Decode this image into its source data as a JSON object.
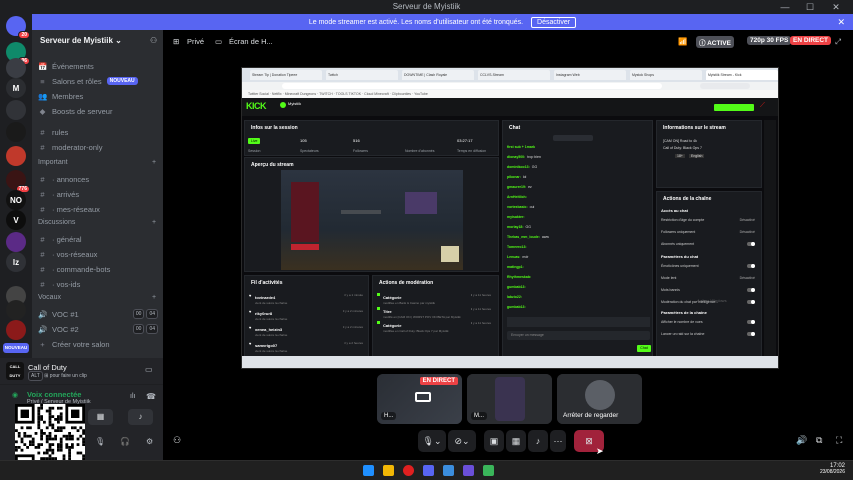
{
  "window": {
    "title": "Serveur de Myistiik",
    "minimize": "—",
    "maximize": "☐",
    "close": "✕"
  },
  "streamer_mode": {
    "message": "Le mode streamer est activé. Les noms d'utilisateur ont été tronqués.",
    "disable_label": "Désactiver",
    "close": "✕"
  },
  "servers": [
    {
      "label": "",
      "badge": "20",
      "color": "#5865f2"
    },
    {
      "label": "",
      "badge": "96",
      "color": "#0f8a6a"
    },
    {
      "label": "",
      "badge": "",
      "color": "#3a3d44"
    },
    {
      "label": "M",
      "badge": "",
      "color": "#2b2d31"
    },
    {
      "label": "",
      "badge": "",
      "color": "#313338"
    },
    {
      "label": "",
      "badge": "",
      "color": "#1a1a1a"
    },
    {
      "label": "",
      "badge": "",
      "color": "#c0392b"
    },
    {
      "label": "",
      "badge": "776",
      "color": "#3a1414"
    },
    {
      "label": "NO",
      "badge": "",
      "color": "#111"
    },
    {
      "label": "V",
      "badge": "",
      "color": "#0d0d0d"
    },
    {
      "label": "",
      "badge": "",
      "color": "#5b2a86"
    },
    {
      "label": "lz",
      "badge": "",
      "color": "#2f3136"
    },
    {
      "label": "",
      "badge": "",
      "color": "#444"
    },
    {
      "label": "",
      "badge": "",
      "color": "#222"
    },
    {
      "label": "",
      "badge": "",
      "color": "#8b1a1a"
    }
  ],
  "rail_new_label": "NOUVEAU",
  "guild": {
    "name": "Serveur de Myistiik",
    "chevron": "⌄"
  },
  "channels": {
    "top": [
      {
        "icon": "📅",
        "label": "Événements"
      },
      {
        "icon": "≡",
        "label": "Salons et rôles",
        "tag": "NOUVEAU"
      },
      {
        "icon": "👥",
        "label": "Membres"
      },
      {
        "icon": "◆",
        "label": "Boosts de serveur"
      }
    ],
    "plain": [
      {
        "icon": "#",
        "label": "rules"
      },
      {
        "icon": "#",
        "label": "moderator-only"
      }
    ],
    "cat_important": "Important",
    "important": [
      {
        "icon": "#",
        "label": "· annonces"
      },
      {
        "icon": "#",
        "label": "· arrivés"
      },
      {
        "icon": "#",
        "label": "· mes-réseaux"
      }
    ],
    "cat_discussions": "Discussions",
    "discussions": [
      {
        "icon": "#",
        "label": "· général"
      },
      {
        "icon": "#",
        "label": "· vos-réseaux"
      },
      {
        "icon": "#",
        "label": "· commande-bots"
      },
      {
        "icon": "#",
        "label": "· vos-ids"
      }
    ],
    "cat_vocaux": "Vocaux",
    "vocaux": [
      {
        "icon": "🔊",
        "label": "VOC #1",
        "a": "00",
        "b": "04"
      },
      {
        "icon": "🔊",
        "label": "VOC #2",
        "a": "00",
        "b": "04"
      }
    ],
    "create_voice": "Créer votre salon"
  },
  "activity": {
    "game": "Call of Duty",
    "sub": "pour faire un clip",
    "key": "ALT"
  },
  "voice": {
    "status": "Voix connectée",
    "location": "Privé / Serveur de Myistiik"
  },
  "channel_header": {
    "privacy": "Privé",
    "title": "Écran de H...",
    "active": "ACTIVE",
    "quality": "720p 30 FPS",
    "live": "EN DIRECT"
  },
  "stream": {
    "tabs": [
      "Stream Tip | Donation Tipeee",
      "Twitch",
      "DOWNTIME | Clash Royale",
      "CCLVS-Stream",
      "Instagram Web",
      "Mystok Shops",
      "Myistiik Stream - Kick"
    ],
    "bookmarks": "Twitter Social · Netflix · Minecraft Dungeons · TWITCH · TOOLS TIKTOK · Cloud Minecraft · Clipbounties · YouTube",
    "kick": {
      "logo": "KICK",
      "streamer": "Myistiik",
      "session_title": "Infos sur la session",
      "live_badge": "Live",
      "session_label": "Session",
      "viewers_val": "105",
      "viewers_label": "Spectateurs",
      "followers_val": "516",
      "followers_label": "Followers",
      "subs_label": "Nombre d'abonnés",
      "time_val": "03:27:17",
      "time_label": "Temps en diffusion",
      "preview_title": "Aperçu du stream",
      "chat_title": "Chat",
      "chat_lines": [
        {
          "u": "first sub + 1mark",
          "t": ""
        },
        {
          "u": "dionay500:",
          "t": "trop bien"
        },
        {
          "u": "dominikoo13:",
          "t": "GG"
        },
        {
          "u": "pikonar:",
          "t": "lol"
        },
        {
          "u": "gmaurer19:",
          "t": "ez"
        },
        {
          "u": "ArnHeitlich:",
          "t": ""
        },
        {
          "u": "vortexbasic:",
          "t": "oui"
        },
        {
          "u": "myisakter:",
          "t": ""
        },
        {
          "u": "morlay18:",
          "t": "GG"
        },
        {
          "u": "Thebas_mm_loude:",
          "t": "aww"
        },
        {
          "u": "Tomeero13:",
          "t": ""
        },
        {
          "u": "Lenuas:",
          "t": "mdr"
        },
        {
          "u": "matingp1:",
          "t": ""
        },
        {
          "u": "Rhythmeskab:",
          "t": ""
        },
        {
          "u": "gumbab13:",
          "t": ""
        },
        {
          "u": "labzio22:",
          "t": ""
        },
        {
          "u": "gumbab13:",
          "t": ""
        }
      ],
      "chat_placeholder": "Envoyer un message",
      "chat_send": "Chat",
      "info_title": "Informations sur le stream",
      "info_line": "[CAM ON] Road to 4k",
      "info_game": "Call of Duty: Black Ops 7",
      "info_tags": [
        "18+",
        "English"
      ],
      "actions_title": "Actions de la chaîne",
      "chat_access": "Accès au chat",
      "settings": [
        {
          "label": "Restriction d'âge du compte",
          "value": "Désactivé"
        },
        {
          "label": "Followers uniquement",
          "value": "Désactivé"
        },
        {
          "label": "Abonnés uniquement",
          "value": ""
        }
      ],
      "chat_params": "Paramètres du chat",
      "chat_settings": [
        {
          "label": "Émoticônes uniquement",
          "value": ""
        },
        {
          "label": "Mode lent",
          "value": "Désactivé"
        },
        {
          "label": "Mots bannis",
          "value": ""
        },
        {
          "label": "Modération du chat par intelligence...",
          "value": ""
        }
      ],
      "channel_params": "Paramètres de la chaîne",
      "channel_settings": [
        {
          "label": "Afficher le nombre de vues",
          "value": ""
        },
        {
          "label": "Lancer un raid sur la chaîne",
          "value": ""
        }
      ],
      "activity_title": "Fil d'activités",
      "activity_rows": [
        {
          "name": "tovinarde4",
          "sub": "vient de suivre la chaîne",
          "time": "il y a 1 minute"
        },
        {
          "name": "riky0rur8",
          "sub": "vient de suivre la chaîne",
          "time": "il y a 2 minutes"
        },
        {
          "name": "xenea_heizin3",
          "sub": "vient de suivre la chaîne",
          "time": "il y a 2 minutes"
        },
        {
          "name": "samvrigo07",
          "sub": "vient de suivre la chaîne",
          "time": "il y a 2 heures"
        }
      ],
      "mod_title": "Actions de modération",
      "mod_rows": [
        {
          "name": "Catégorie",
          "sub": "modifiée en Bank & Casino par myistiik",
          "time": "il y a 11 heures"
        },
        {
          "name": "Titre",
          "sub": "modifié en [CAM ON | WORST POV ON BETA par Myistiik",
          "time": "il y a 11 heures"
        },
        {
          "name": "Catégorie",
          "sub": "modifiée en Call of Duty: Black Ops 7 par Myistiik",
          "time": "il y a 11 heures"
        }
      ],
      "windows_activate": "Activer Windows"
    }
  },
  "participants": [
    {
      "name": "H...",
      "live": "EN DIRECT"
    },
    {
      "name": "M...",
      "live": ""
    },
    {
      "name": "Arrêter de regarder",
      "live": ""
    }
  ],
  "taskbar": {
    "time": "17:02",
    "date": "23/08/2026"
  },
  "colors": {
    "blurple": "#5865f2",
    "live_red": "#ed4245",
    "kick_green": "#53fc18",
    "voice_green": "#23a55a",
    "stop_red": "#a1223b"
  }
}
